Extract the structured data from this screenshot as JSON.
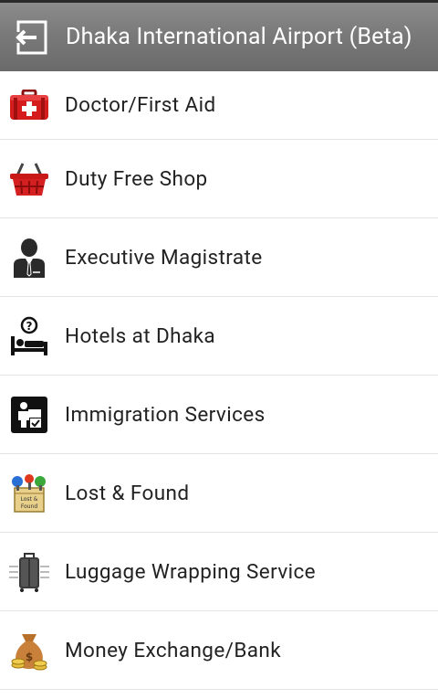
{
  "actionbar": {
    "title": "Dhaka International Airport (Beta)",
    "back_icon": "back-arrow-icon"
  },
  "items": [
    {
      "label": "Doctor/First Aid",
      "icon": "first-aid-kit-icon"
    },
    {
      "label": "Duty Free Shop",
      "icon": "shopping-basket-icon"
    },
    {
      "label": "Executive Magistrate",
      "icon": "officer-icon"
    },
    {
      "label": "Hotels at Dhaka",
      "icon": "hotel-bed-icon"
    },
    {
      "label": "Immigration Services",
      "icon": "immigration-icon"
    },
    {
      "label": "Lost & Found",
      "icon": "lost-found-icon"
    },
    {
      "label": "Luggage Wrapping Service",
      "icon": "luggage-icon"
    },
    {
      "label": "Money Exchange/Bank",
      "icon": "money-bag-icon"
    }
  ],
  "colors": {
    "actionbar_bg": "#7a7a7a",
    "text": "#222222",
    "divider": "#e3e3e3"
  }
}
